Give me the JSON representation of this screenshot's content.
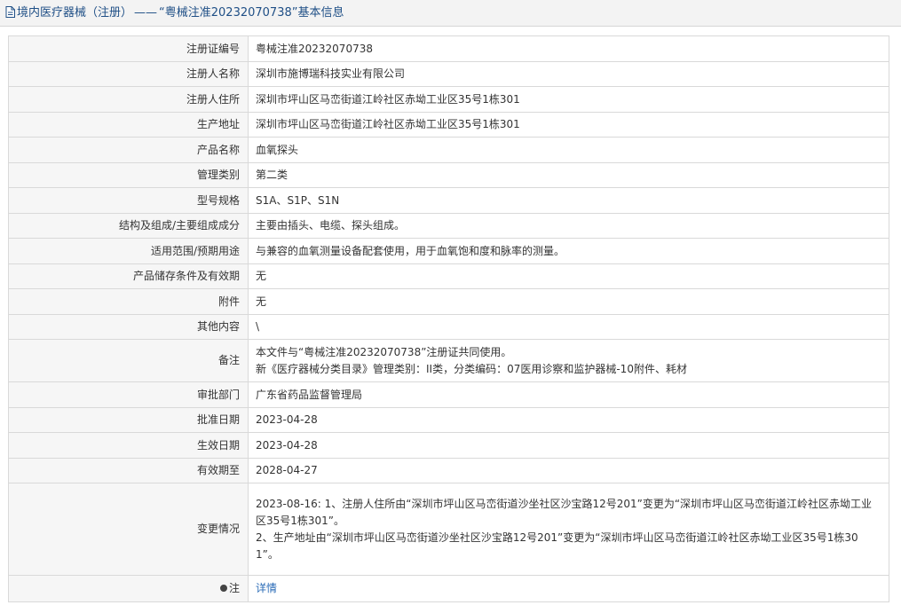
{
  "header": {
    "category": "境内医疗器械（注册）",
    "separator": "——",
    "record_title": "“粤械注准20232070738”基本信息"
  },
  "rows": [
    {
      "label": "注册证编号",
      "value": "粤械注准20232070738"
    },
    {
      "label": "注册人名称",
      "value": "深圳市施博瑞科技实业有限公司"
    },
    {
      "label": "注册人住所",
      "value": "深圳市坪山区马峦街道江岭社区赤坳工业区35号1栋301"
    },
    {
      "label": "生产地址",
      "value": "深圳市坪山区马峦街道江岭社区赤坳工业区35号1栋301"
    },
    {
      "label": "产品名称",
      "value": "血氧探头"
    },
    {
      "label": "管理类别",
      "value": "第二类"
    },
    {
      "label": "型号规格",
      "value": "S1A、S1P、S1N"
    },
    {
      "label": "结构及组成/主要组成成分",
      "value": "主要由插头、电缆、探头组成。"
    },
    {
      "label": "适用范围/预期用途",
      "value": "与兼容的血氧测量设备配套使用，用于血氧饱和度和脉率的测量。"
    },
    {
      "label": "产品储存条件及有效期",
      "value": "无"
    },
    {
      "label": "附件",
      "value": "无"
    },
    {
      "label": "其他内容",
      "value": "\\"
    }
  ],
  "remarks": {
    "label": "备注",
    "lines": [
      "本文件与“粤械注准20232070738”注册证共同使用。",
      "新《医疗器械分类目录》管理类别：II类，分类编码：07医用诊察和监护器械-10附件、耗材"
    ]
  },
  "rows2": [
    {
      "label": "审批部门",
      "value": "广东省药品监督管理局"
    },
    {
      "label": "批准日期",
      "value": "2023-04-28"
    },
    {
      "label": "生效日期",
      "value": "2023-04-28"
    },
    {
      "label": "有效期至",
      "value": "2028-04-27"
    }
  ],
  "changes": {
    "label": "变更情况",
    "lines": [
      "2023-08-16: 1、注册人住所由“深圳市坪山区马峦街道沙坐社区沙宝路12号201”变更为“深圳市坪山区马峦街道江岭社区赤坳工业",
      "区35号1栋301”。",
      "2、生产地址由“深圳市坪山区马峦街道沙坐社区沙宝路12号201”变更为“深圳市坪山区马峦街道江岭社区赤坳工业区35号1栋30",
      "1”。"
    ]
  },
  "note": {
    "label": "注",
    "icon": "info-dot-icon",
    "link_text": "详情"
  }
}
